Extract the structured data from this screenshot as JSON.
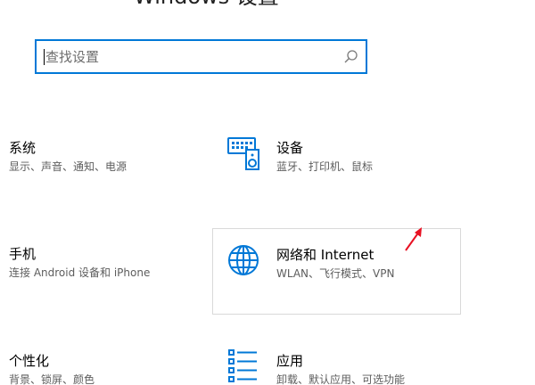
{
  "page": {
    "title": "Windows 设置"
  },
  "search": {
    "placeholder": "查找设置",
    "value": ""
  },
  "tiles": {
    "system": {
      "title": "系统",
      "desc": "显示、声音、通知、电源"
    },
    "devices": {
      "title": "设备",
      "desc": "蓝牙、打印机、鼠标"
    },
    "phone": {
      "title": "手机",
      "desc": "连接 Android 设备和 iPhone"
    },
    "network": {
      "title": "网络和 Internet",
      "desc": "WLAN、飞行模式、VPN"
    },
    "personalization": {
      "title": "个性化",
      "desc": "背景、锁屏、颜色"
    },
    "apps": {
      "title": "应用",
      "desc": "卸载、默认应用、可选功能"
    }
  },
  "colors": {
    "accent": "#0078d7",
    "annotation": "#e81123"
  },
  "icons": {
    "search": "search-icon",
    "devices": "keyboard-speaker-icon",
    "network": "globe-icon",
    "apps": "app-list-icon"
  }
}
